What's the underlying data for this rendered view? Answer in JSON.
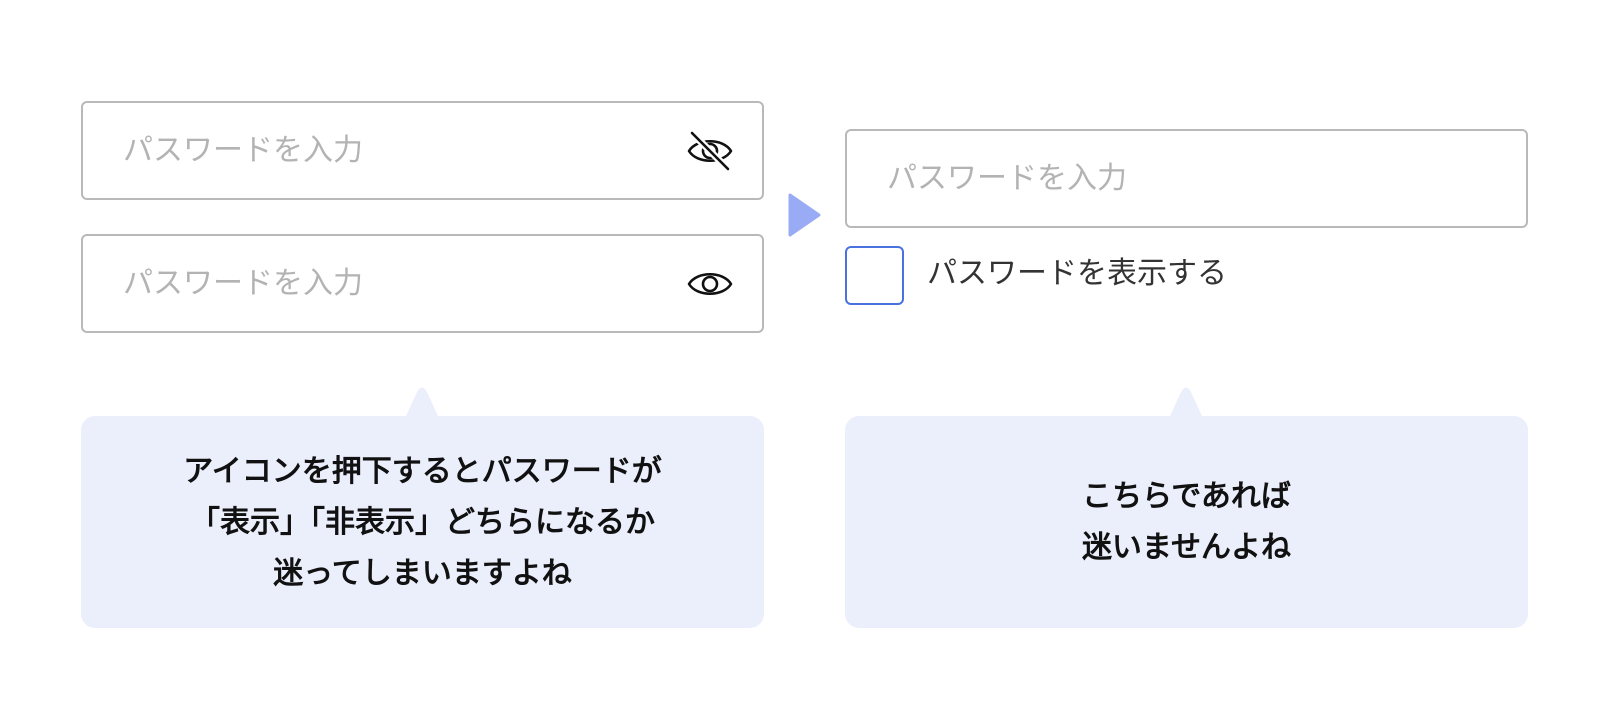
{
  "left_example": {
    "field_hidden": {
      "placeholder": "パスワードを入力",
      "value": "",
      "icon": "eye-off-icon"
    },
    "field_visible": {
      "placeholder": "パスワードを入力",
      "value": "",
      "icon": "eye-icon"
    },
    "note": {
      "lines": [
        "アイコンを押下するとパスワードが",
        "「表示」「非表示」どちらになるか",
        "迷ってしまいますよね"
      ]
    }
  },
  "arrow": {
    "icon": "arrow-right-icon",
    "color": "#9aabf5"
  },
  "right_example": {
    "field": {
      "placeholder": "パスワードを入力",
      "value": ""
    },
    "checkbox": {
      "label": "パスワードを表示する",
      "checked": false
    },
    "note": {
      "lines": [
        "こちらであれば",
        "迷いませんよね"
      ]
    }
  },
  "colors": {
    "field_border": "#b9b9b9",
    "placeholder": "#b3b3b3",
    "checkbox_border": "#4a71e0",
    "note_background": "#ebeffc",
    "arrow": "#9aabf5"
  }
}
